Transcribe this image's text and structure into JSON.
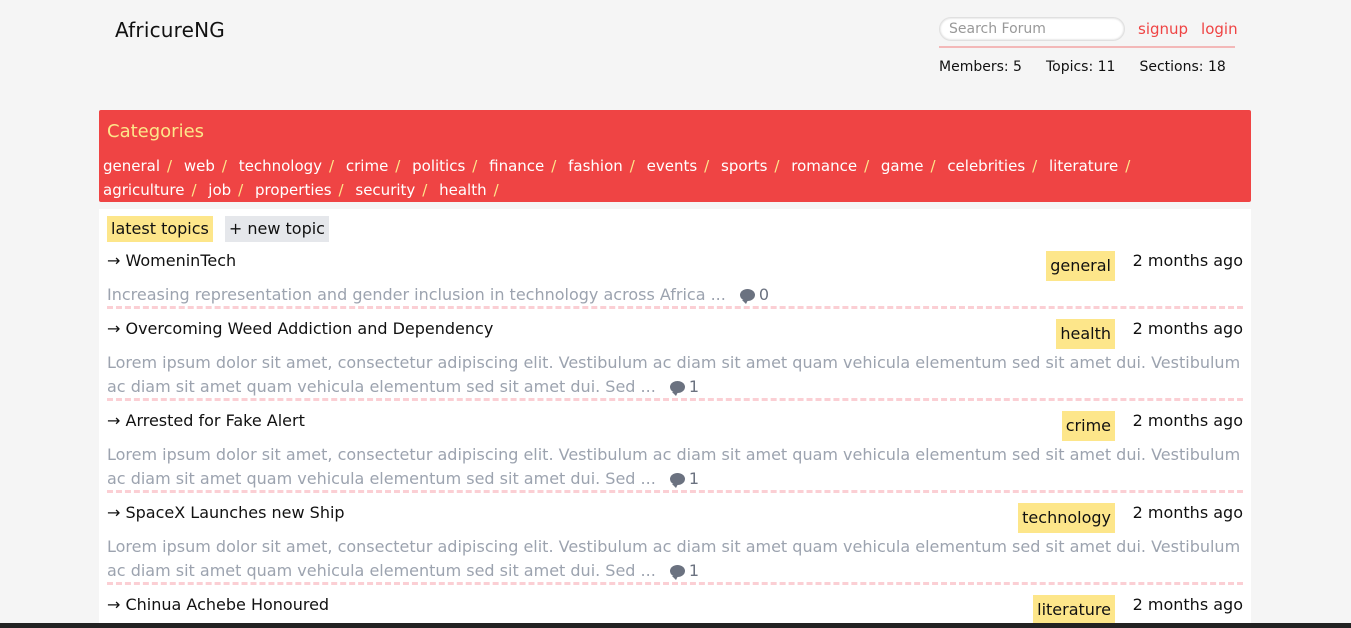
{
  "brand": "AfricureNG",
  "search": {
    "placeholder": "Search Forum"
  },
  "auth": {
    "signup": "signup",
    "login": "login"
  },
  "stats": {
    "members": "Members: 5",
    "topics": "Topics: 11",
    "sections": "Sections: 18"
  },
  "categories": {
    "title": "Categories",
    "separator": "/",
    "items": [
      "general",
      "web",
      "technology",
      "crime",
      "politics",
      "finance",
      "fashion",
      "events",
      "sports",
      "romance",
      "game",
      "celebrities",
      "literature",
      "agriculture",
      "job",
      "properties",
      "security",
      "health"
    ]
  },
  "tabs": {
    "latest": "latest topics",
    "new": "+ new topic"
  },
  "topics": [
    {
      "title": "→ WomeninTech",
      "category": "general",
      "time": "2 months ago",
      "excerpt": "Increasing representation and gender inclusion in technology across Africa ...",
      "comments": "0"
    },
    {
      "title": "→ Overcoming Weed Addiction and Dependency",
      "category": "health",
      "time": "2 months ago",
      "excerpt": "Lorem ipsum dolor sit amet, consectetur adipiscing elit. Vestibulum ac diam sit amet quam vehicula elementum sed sit amet dui. Vestibulum ac diam sit amet quam vehicula elementum sed sit amet dui. Sed ...",
      "comments": "1"
    },
    {
      "title": "→ Arrested for Fake Alert",
      "category": "crime",
      "time": "2 months ago",
      "excerpt": "Lorem ipsum dolor sit amet, consectetur adipiscing elit. Vestibulum ac diam sit amet quam vehicula elementum sed sit amet dui. Vestibulum ac diam sit amet quam vehicula elementum sed sit amet dui. Sed ...",
      "comments": "1"
    },
    {
      "title": "→ SpaceX Launches new Ship",
      "category": "technology",
      "time": "2 months ago",
      "excerpt": "Lorem ipsum dolor sit amet, consectetur adipiscing elit. Vestibulum ac diam sit amet quam vehicula elementum sed sit amet dui. Vestibulum ac diam sit amet quam vehicula elementum sed sit amet dui. Sed ...",
      "comments": "1"
    },
    {
      "title": "→ Chinua Achebe Honoured",
      "category": "literature",
      "time": "2 months ago",
      "excerpt": "",
      "comments": ""
    }
  ]
}
